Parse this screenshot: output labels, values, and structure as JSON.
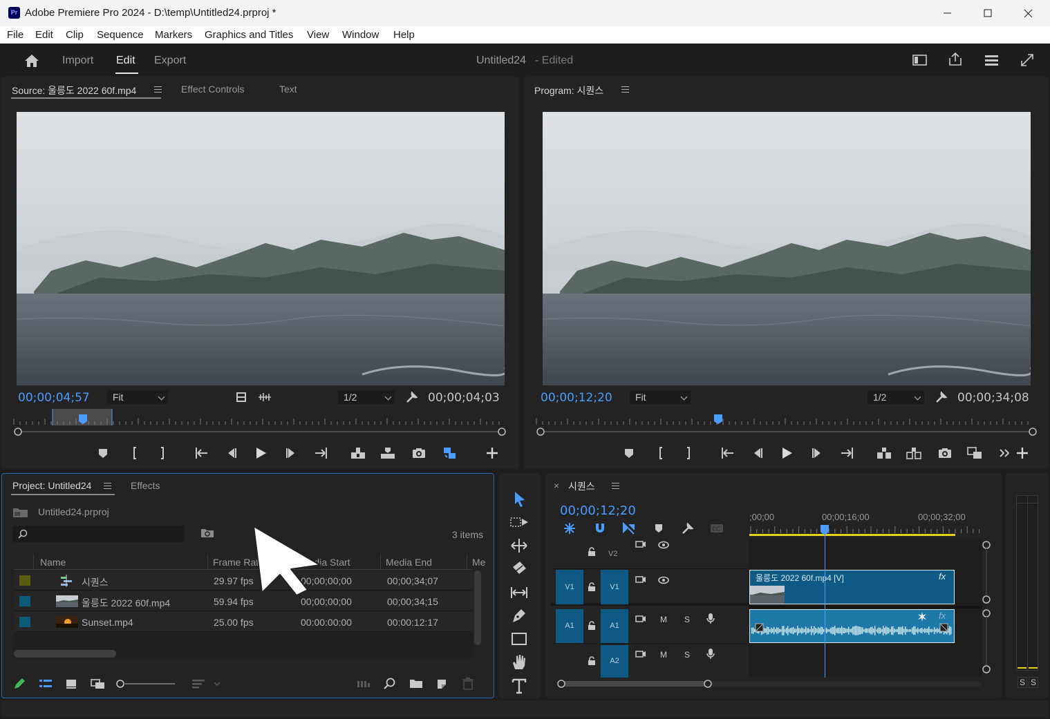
{
  "window": {
    "app_icon_text": "Pr",
    "title": "Adobe Premiere Pro 2024 - D:\\temp\\Untitled24.prproj *"
  },
  "menu": [
    "File",
    "Edit",
    "Clip",
    "Sequence",
    "Markers",
    "Graphics and Titles",
    "View",
    "Window",
    "Help"
  ],
  "header": {
    "nav": [
      "Import",
      "Edit",
      "Export"
    ],
    "active": "Edit",
    "project_name": "Untitled24",
    "project_status": "- Edited"
  },
  "source_monitor": {
    "tabs": [
      "Source: 울릉도 2022 60f.mp4",
      "Effect Controls",
      "Text"
    ],
    "current_time": "00;00;04;57",
    "zoom": "Fit",
    "resolution": "1/2",
    "duration": "00;00;04;03"
  },
  "program_monitor": {
    "tab": "Program: 시퀀스",
    "current_time": "00;00;12;20",
    "zoom": "Fit",
    "resolution": "1/2",
    "duration": "00;00;34;08"
  },
  "project_panel": {
    "tabs": [
      "Project: Untitled24",
      "Effects"
    ],
    "project_file": "Untitled24.prproj",
    "search_placeholder": "",
    "item_count": "3 items",
    "columns": [
      "Name",
      "Frame Rate",
      "Media Start",
      "Media End",
      "Me"
    ],
    "rows": [
      {
        "name": "시퀀스",
        "frame_rate": "29.97 fps",
        "media_start": "00;00;00;00",
        "media_end": "00;00;34;07",
        "color": "#5c5a10",
        "icon": "sequence-icon"
      },
      {
        "name": "울릉도 2022 60f.mp4",
        "frame_rate": "59.94 fps",
        "media_start": "00;00;00;00",
        "media_end": "00;00;34;15",
        "color": "#0c5a7a",
        "icon": "video-thumb"
      },
      {
        "name": "Sunset.mp4",
        "frame_rate": "25.00 fps",
        "media_start": "00:00:00:00",
        "media_end": "00:00:12:17",
        "color": "#0c5a7a",
        "icon": "sunset-thumb"
      }
    ]
  },
  "timeline": {
    "tab": "시퀀스",
    "current_time": "00;00;12;20",
    "ruler_labels": [
      ";00;00",
      "00;00;16;00",
      "00;00;32;00"
    ],
    "tracks": {
      "v2": "V2",
      "v1_src": "V1",
      "v1": "V1",
      "a1_src": "A1",
      "a1": "A1",
      "a2": "A2",
      "mute": "M",
      "solo": "S"
    },
    "video_clip_label": "울릉도 2022 60f.mp4 [V]",
    "fx_label": "fx"
  },
  "audio_meter": {
    "solo_left": "S",
    "solo_right": "S"
  },
  "colors": {
    "accent_blue": "#4a9cff",
    "clip_blue": "#0f5a84",
    "audio_clip": "#1e78a8",
    "work_area_yellow": "#e6d21e"
  }
}
